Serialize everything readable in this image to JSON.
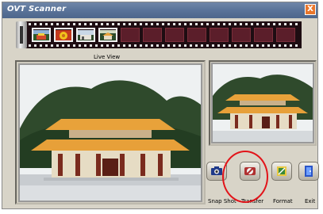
{
  "window": {
    "title": "OVT Scanner",
    "close_label": "X"
  },
  "filmstrip": {
    "thumbnails": [
      {
        "name": "thumb-1-image"
      },
      {
        "name": "thumb-2-image"
      },
      {
        "name": "thumb-3-image"
      },
      {
        "name": "thumb-4-image"
      }
    ],
    "empty_frames": 8
  },
  "labels": {
    "live_view": "Live  View"
  },
  "buttons": [
    {
      "id": "snapshot",
      "label": "Snap Shot",
      "icon": "camera-icon"
    },
    {
      "id": "transfer",
      "label": "Transfer",
      "icon": "transfer-icon"
    },
    {
      "id": "format",
      "label": "Format",
      "icon": "format-icon"
    },
    {
      "id": "exit",
      "label": "Exit",
      "icon": "exit-door-icon"
    }
  ],
  "colors": {
    "titlebar": "#5a7399",
    "film": "#1e0d12",
    "empty_frame": "#5b1e2a",
    "highlight_circle": "#e2141a",
    "roof": "#e8a23a"
  }
}
